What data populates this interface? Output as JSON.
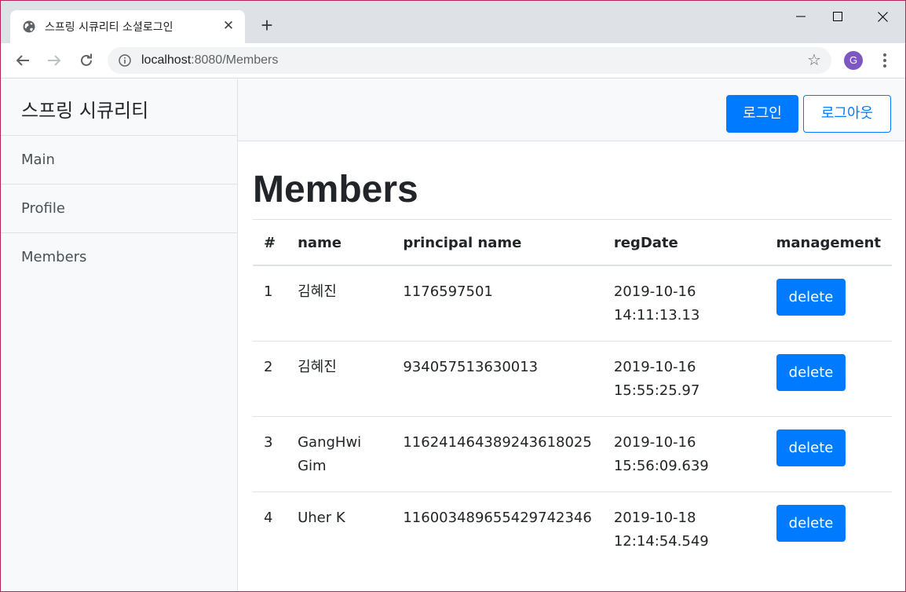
{
  "browser": {
    "tab_title": "스프링 시큐리티 소셜로그인",
    "tab_close": "✕",
    "new_tab": "+",
    "url_host": "localhost",
    "url_rest": ":8080/Members",
    "avatar_letter": "G",
    "star": "☆"
  },
  "sidebar": {
    "heading": "스프링 시큐리티",
    "items": [
      "Main",
      "Profile",
      "Members"
    ]
  },
  "topnav": {
    "login_label": "로그인",
    "logout_label": "로그아웃"
  },
  "main": {
    "title": "Members",
    "table": {
      "headers": [
        "#",
        "name",
        "principal name",
        "regDate",
        "management"
      ],
      "rows": [
        {
          "num": "1",
          "name": "김혜진",
          "principal": "1176597501",
          "date": "2019-10-16",
          "time": "14:11:13.13",
          "action": "delete"
        },
        {
          "num": "2",
          "name": "김혜진",
          "principal": "934057513630013",
          "date": "2019-10-16",
          "time": "15:55:25.97",
          "action": "delete"
        },
        {
          "num": "3",
          "name": "GangHwi Gim",
          "principal": "116241464389243618025",
          "date": "2019-10-16",
          "time": "15:56:09.639",
          "action": "delete"
        },
        {
          "num": "4",
          "name": "Uher K",
          "principal": "116003489655429742346",
          "date": "2019-10-18",
          "time": "12:14:54.549",
          "action": "delete"
        }
      ]
    }
  },
  "colors": {
    "primary": "#007bff",
    "sidebar_bg": "#f8f9fa",
    "tabstrip_bg": "#dee1e6"
  }
}
